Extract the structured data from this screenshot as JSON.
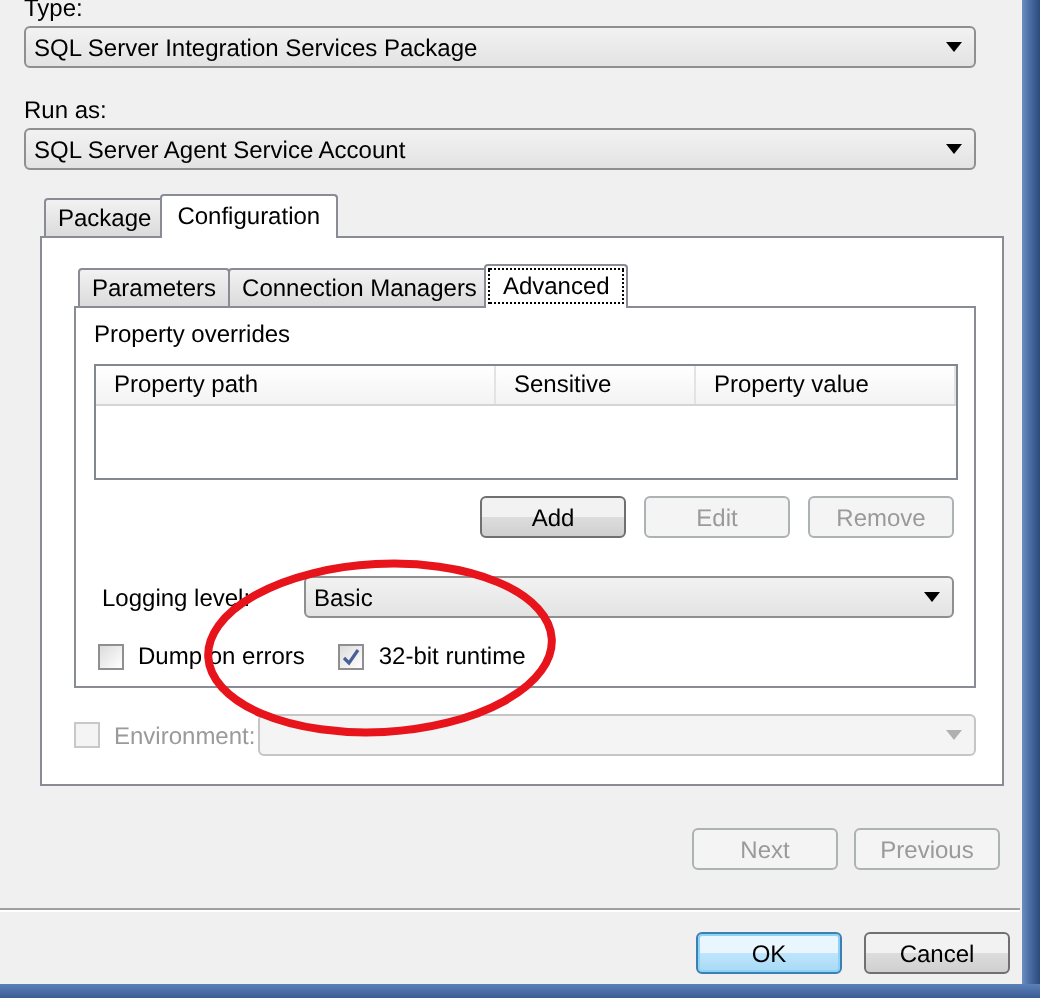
{
  "type_field": {
    "label": "Type:",
    "value": "SQL Server Integration Services Package"
  },
  "run_as": {
    "label": "Run as:",
    "value": "SQL Server Agent Service Account"
  },
  "outer_tabs": [
    {
      "label": "Package",
      "selected": false
    },
    {
      "label": "Configuration",
      "selected": true
    }
  ],
  "inner_tabs": [
    {
      "label": "Parameters",
      "selected": false
    },
    {
      "label": "Connection Managers",
      "selected": false
    },
    {
      "label": "Advanced",
      "selected": true
    }
  ],
  "property_overrides": {
    "label": "Property overrides",
    "columns": [
      "Property path",
      "Sensitive",
      "Property value"
    ]
  },
  "list_buttons": [
    {
      "label": "Add",
      "disabled": false
    },
    {
      "label": "Edit",
      "disabled": true
    },
    {
      "label": "Remove",
      "disabled": true
    }
  ],
  "logging_level": {
    "label": "Logging level:",
    "value": "Basic"
  },
  "options": [
    {
      "label": "Dump on errors",
      "checked": false
    },
    {
      "label": "32-bit runtime",
      "checked": true
    }
  ],
  "environment": {
    "label": "Environment:",
    "checked": false,
    "disabled": true
  },
  "nav_buttons": [
    {
      "label": "Next",
      "disabled": true
    },
    {
      "label": "Previous",
      "disabled": true
    }
  ],
  "dialog_buttons": [
    {
      "label": "OK",
      "default": true,
      "disabled": false
    },
    {
      "label": "Cancel",
      "default": false,
      "disabled": false
    }
  ],
  "annotation": {
    "kind": "ellipse"
  }
}
